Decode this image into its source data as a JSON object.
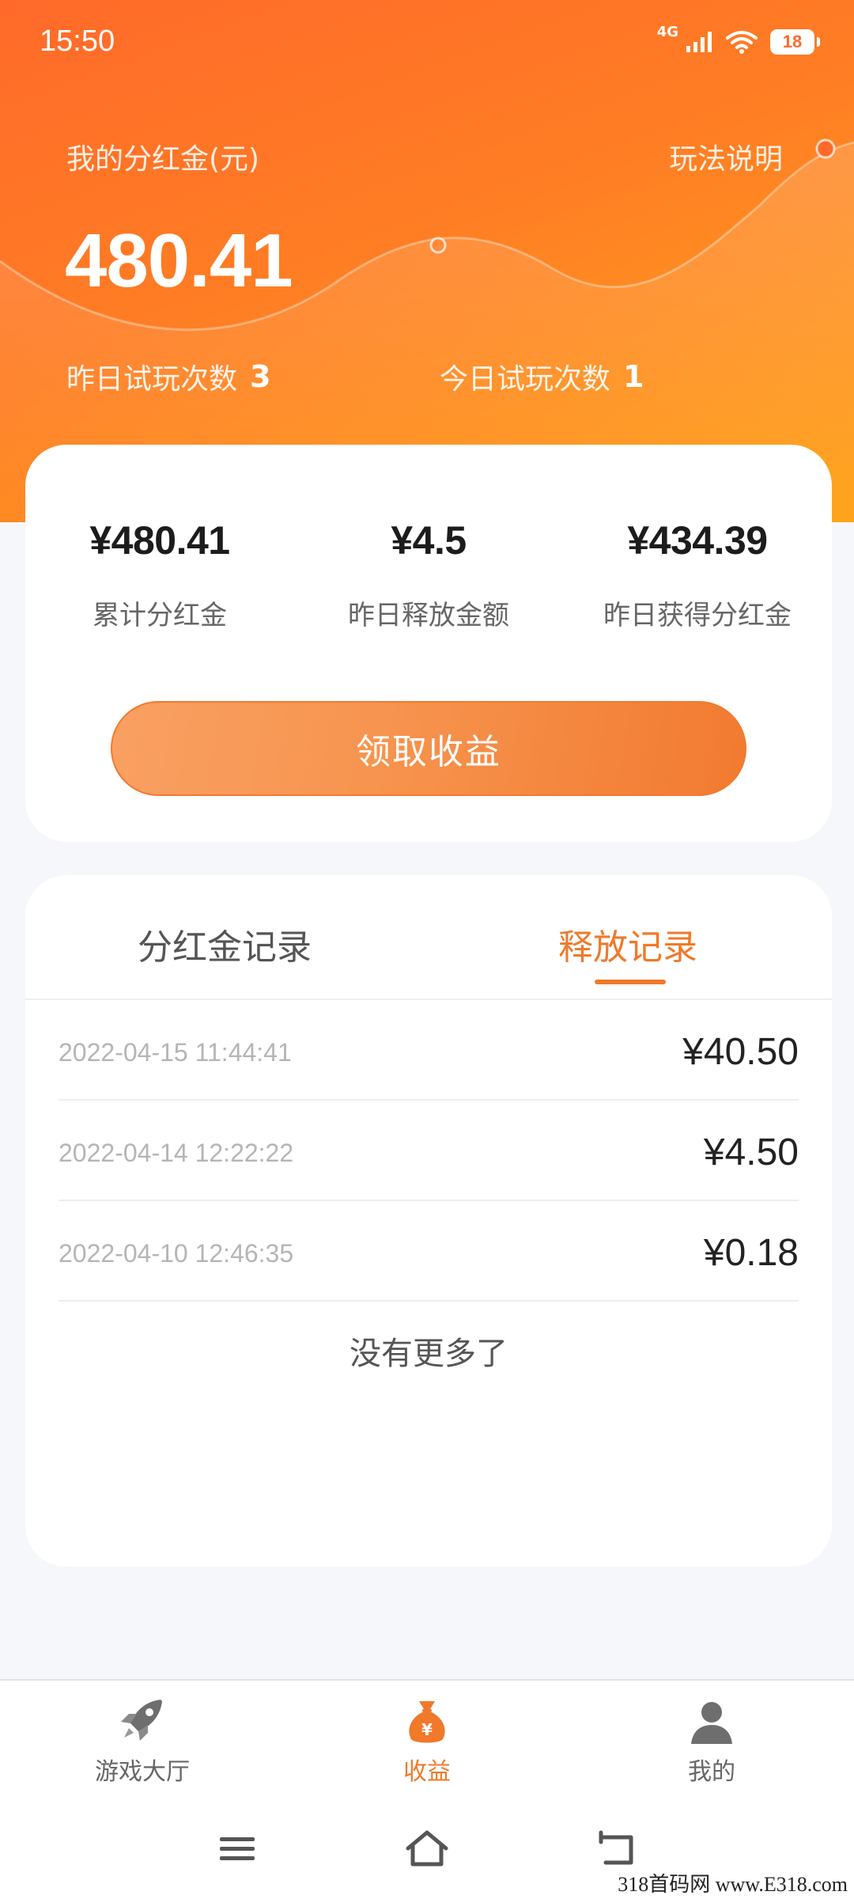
{
  "status_bar": {
    "time": "15:50",
    "network": "4G",
    "battery": "18"
  },
  "header": {
    "bonus_label": "我的分红金(元)",
    "rules_link": "玩法说明",
    "bonus_amount": "480.41",
    "yesterday_plays_label": "昨日试玩次数",
    "yesterday_plays_value": "3",
    "today_plays_label": "今日试玩次数",
    "today_plays_value": "1"
  },
  "summary": {
    "stats": [
      {
        "value": "¥480.41",
        "label": "累计分红金"
      },
      {
        "value": "¥4.5",
        "label": "昨日释放金额"
      },
      {
        "value": "¥434.39",
        "label": "昨日获得分红金"
      }
    ],
    "claim_button": "领取收益"
  },
  "records": {
    "tabs": [
      {
        "label": "分红金记录",
        "active": false
      },
      {
        "label": "释放记录",
        "active": true
      }
    ],
    "rows": [
      {
        "date": "2022-04-15 11:44:41",
        "amount": "¥40.50"
      },
      {
        "date": "2022-04-14 12:22:22",
        "amount": "¥4.50"
      },
      {
        "date": "2022-04-10 12:46:35",
        "amount": "¥0.18"
      }
    ],
    "no_more": "没有更多了"
  },
  "bottom_nav": {
    "items": [
      {
        "label": "游戏大厅",
        "icon": "rocket-icon",
        "active": false
      },
      {
        "label": "收益",
        "icon": "money-bag-icon",
        "active": true
      },
      {
        "label": "我的",
        "icon": "user-icon",
        "active": false
      }
    ]
  },
  "watermark": "318首码网 www.E318.com",
  "colors": {
    "accent": "#f0792a",
    "header_start": "#ff6a2a",
    "header_end": "#ffa41c"
  }
}
